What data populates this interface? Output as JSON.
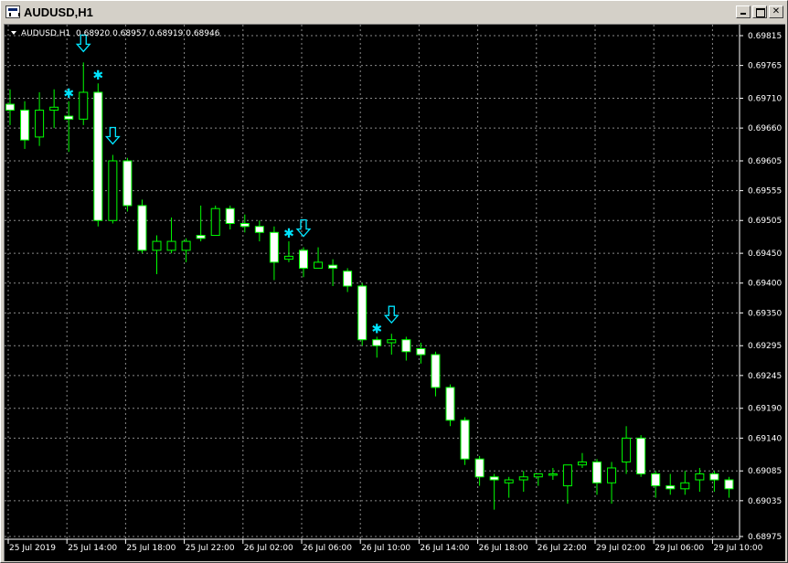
{
  "window": {
    "title": "AUDUSD,H1",
    "buttons": {
      "minimize": "minimize",
      "maximize": "maximize",
      "close": "✕"
    }
  },
  "header": {
    "symbol": "AUDUSD,H1",
    "ohlc": "0.68920 0.68957 0.68919 0.68946"
  },
  "colors": {
    "background": "#000000",
    "grid": "#8a8a8a",
    "bull_wick": "#00ff00",
    "bear_body": "#ffffff",
    "marker": "#00e5ff"
  },
  "chart_data": {
    "type": "candlestick",
    "symbol": "AUDUSD",
    "timeframe": "H1",
    "y_ticks": [
      "0.69815",
      "0.69765",
      "0.69710",
      "0.69660",
      "0.69605",
      "0.69555",
      "0.69505",
      "0.69450",
      "0.69400",
      "0.69350",
      "0.69295",
      "0.69245",
      "0.69190",
      "0.69140",
      "0.69085",
      "0.69035",
      "0.68975"
    ],
    "x_ticks": [
      "25 Jul 2019",
      "25 Jul 14:00",
      "25 Jul 18:00",
      "25 Jul 22:00",
      "26 Jul 02:00",
      "26 Jul 06:00",
      "26 Jul 10:00",
      "26 Jul 14:00",
      "26 Jul 18:00",
      "26 Jul 22:00",
      "29 Jul 02:00",
      "29 Jul 06:00",
      "29 Jul 10:00"
    ],
    "candles": [
      {
        "o": 0.697,
        "h": 0.69725,
        "l": 0.69665,
        "c": 0.6969
      },
      {
        "o": 0.6969,
        "h": 0.69705,
        "l": 0.69625,
        "c": 0.6964
      },
      {
        "o": 0.69645,
        "h": 0.6972,
        "l": 0.6963,
        "c": 0.6969
      },
      {
        "o": 0.6969,
        "h": 0.69725,
        "l": 0.6966,
        "c": 0.69695
      },
      {
        "o": 0.6968,
        "h": 0.69705,
        "l": 0.6962,
        "c": 0.69675
      },
      {
        "o": 0.69675,
        "h": 0.6977,
        "l": 0.69665,
        "c": 0.6972
      },
      {
        "o": 0.6972,
        "h": 0.69735,
        "l": 0.69495,
        "c": 0.69505
      },
      {
        "o": 0.69505,
        "h": 0.69615,
        "l": 0.695,
        "c": 0.69605
      },
      {
        "o": 0.69605,
        "h": 0.6961,
        "l": 0.6952,
        "c": 0.6953
      },
      {
        "o": 0.6953,
        "h": 0.6954,
        "l": 0.6945,
        "c": 0.69455
      },
      {
        "o": 0.69455,
        "h": 0.6948,
        "l": 0.69415,
        "c": 0.6947
      },
      {
        "o": 0.69455,
        "h": 0.6951,
        "l": 0.6945,
        "c": 0.6947
      },
      {
        "o": 0.69455,
        "h": 0.69475,
        "l": 0.69435,
        "c": 0.6947
      },
      {
        "o": 0.6948,
        "h": 0.6953,
        "l": 0.6947,
        "c": 0.69475
      },
      {
        "o": 0.6948,
        "h": 0.6953,
        "l": 0.6948,
        "c": 0.69525
      },
      {
        "o": 0.69525,
        "h": 0.6953,
        "l": 0.6949,
        "c": 0.695
      },
      {
        "o": 0.695,
        "h": 0.69515,
        "l": 0.69485,
        "c": 0.69495
      },
      {
        "o": 0.69495,
        "h": 0.69505,
        "l": 0.6947,
        "c": 0.69485
      },
      {
        "o": 0.69485,
        "h": 0.69495,
        "l": 0.69405,
        "c": 0.69435
      },
      {
        "o": 0.6944,
        "h": 0.6947,
        "l": 0.69435,
        "c": 0.69445
      },
      {
        "o": 0.69455,
        "h": 0.6946,
        "l": 0.6941,
        "c": 0.69425
      },
      {
        "o": 0.69425,
        "h": 0.6946,
        "l": 0.69425,
        "c": 0.69435
      },
      {
        "o": 0.6943,
        "h": 0.6944,
        "l": 0.69395,
        "c": 0.69425
      },
      {
        "o": 0.6942,
        "h": 0.69425,
        "l": 0.69385,
        "c": 0.69395
      },
      {
        "o": 0.69395,
        "h": 0.694,
        "l": 0.69295,
        "c": 0.69305
      },
      {
        "o": 0.69305,
        "h": 0.6931,
        "l": 0.69275,
        "c": 0.69295
      },
      {
        "o": 0.693,
        "h": 0.69315,
        "l": 0.6928,
        "c": 0.69305
      },
      {
        "o": 0.69305,
        "h": 0.6931,
        "l": 0.6927,
        "c": 0.69285
      },
      {
        "o": 0.6929,
        "h": 0.693,
        "l": 0.69265,
        "c": 0.6928
      },
      {
        "o": 0.6928,
        "h": 0.69285,
        "l": 0.6921,
        "c": 0.69225
      },
      {
        "o": 0.69225,
        "h": 0.6923,
        "l": 0.6916,
        "c": 0.6917
      },
      {
        "o": 0.6917,
        "h": 0.69175,
        "l": 0.69095,
        "c": 0.69105
      },
      {
        "o": 0.69105,
        "h": 0.6911,
        "l": 0.6906,
        "c": 0.69075
      },
      {
        "o": 0.69075,
        "h": 0.6908,
        "l": 0.6902,
        "c": 0.6907
      },
      {
        "o": 0.69065,
        "h": 0.69075,
        "l": 0.6904,
        "c": 0.6907
      },
      {
        "o": 0.6907,
        "h": 0.69085,
        "l": 0.6905,
        "c": 0.69075
      },
      {
        "o": 0.69075,
        "h": 0.6908,
        "l": 0.6906,
        "c": 0.6908
      },
      {
        "o": 0.6908,
        "h": 0.6909,
        "l": 0.6907,
        "c": 0.6908
      },
      {
        "o": 0.6906,
        "h": 0.6909,
        "l": 0.6903,
        "c": 0.69095
      },
      {
        "o": 0.69095,
        "h": 0.69115,
        "l": 0.6909,
        "c": 0.691
      },
      {
        "o": 0.691,
        "h": 0.69105,
        "l": 0.69045,
        "c": 0.69065
      },
      {
        "o": 0.69065,
        "h": 0.691,
        "l": 0.6903,
        "c": 0.6909
      },
      {
        "o": 0.691,
        "h": 0.6916,
        "l": 0.6908,
        "c": 0.6914
      },
      {
        "o": 0.6914,
        "h": 0.69145,
        "l": 0.69075,
        "c": 0.6908
      },
      {
        "o": 0.6908,
        "h": 0.69085,
        "l": 0.6904,
        "c": 0.6906
      },
      {
        "o": 0.6906,
        "h": 0.6908,
        "l": 0.69045,
        "c": 0.69055
      },
      {
        "o": 0.69055,
        "h": 0.69085,
        "l": 0.69045,
        "c": 0.69065
      },
      {
        "o": 0.6907,
        "h": 0.6909,
        "l": 0.6905,
        "c": 0.6908
      },
      {
        "o": 0.6908,
        "h": 0.69085,
        "l": 0.6905,
        "c": 0.6907
      },
      {
        "o": 0.6907,
        "h": 0.69075,
        "l": 0.6904,
        "c": 0.69055
      }
    ],
    "signals": [
      {
        "type": "star",
        "index": 4
      },
      {
        "type": "arrow-down",
        "index": 5
      },
      {
        "type": "star",
        "index": 6
      },
      {
        "type": "arrow-down",
        "index": 7
      },
      {
        "type": "star",
        "index": 19
      },
      {
        "type": "arrow-down",
        "index": 20
      },
      {
        "type": "star",
        "index": 25
      },
      {
        "type": "arrow-down",
        "index": 26
      }
    ]
  }
}
